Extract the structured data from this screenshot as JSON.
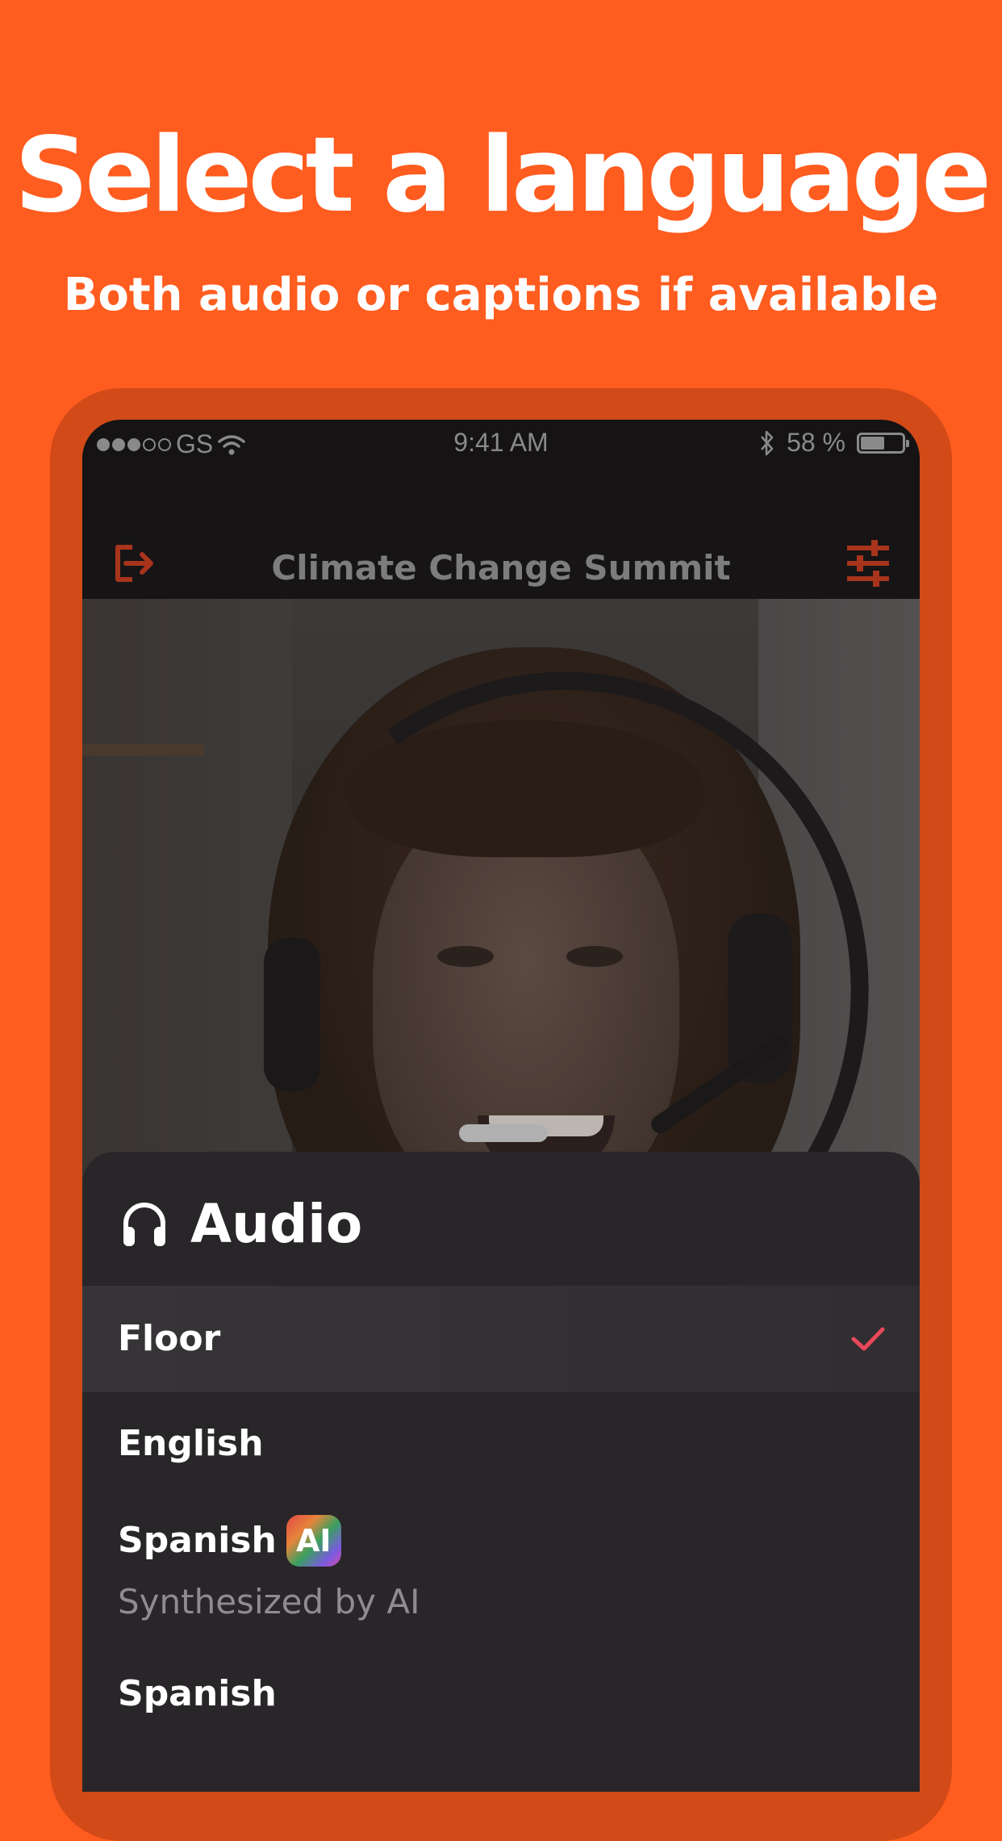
{
  "promo": {
    "title": "Select a language",
    "subtitle": "Both audio or captions if available"
  },
  "status_bar": {
    "carrier": "GS",
    "time": "9:41 AM",
    "battery_percent": "58 %",
    "battery_level": 0.58,
    "signal_bars_filled": 3,
    "signal_bars_total": 5
  },
  "app_header": {
    "title": "Climate Change Summit",
    "left_icon": "exit-icon",
    "right_icon": "sliders-icon",
    "icon_color": "#A8341C"
  },
  "sheet": {
    "icon": "headphones-icon",
    "title": "Audio",
    "items": [
      {
        "label": "Floor",
        "selected": true
      },
      {
        "label": "English",
        "selected": false
      },
      {
        "label": "Spanish",
        "badge": "AI",
        "subtitle": "Synthesized by AI",
        "selected": false
      },
      {
        "label": "Spanish",
        "selected": false
      }
    ],
    "check_color": "#E8485A"
  },
  "colors": {
    "background": "#FF5C1F",
    "frame": "#D24A17",
    "sheet": "#282628"
  }
}
